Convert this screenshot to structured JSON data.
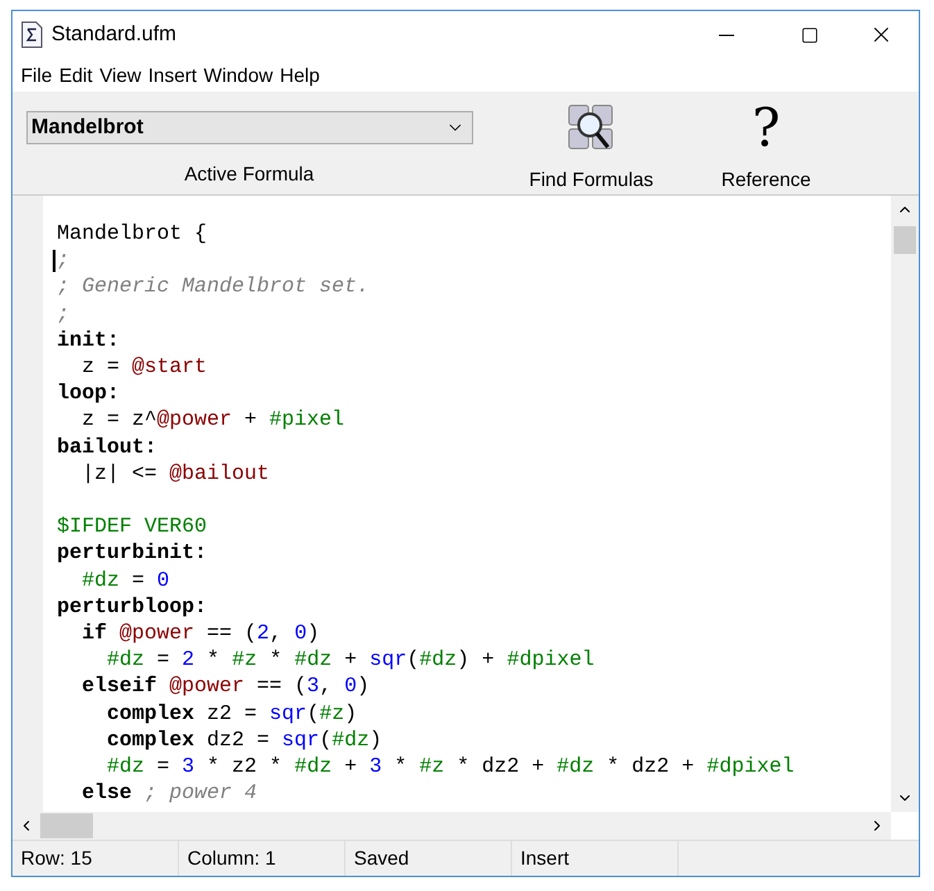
{
  "window": {
    "title": "Standard.ufm"
  },
  "menu": [
    "File",
    "Edit",
    "View",
    "Insert",
    "Window",
    "Help"
  ],
  "toolbar": {
    "formula_select": {
      "value": "Mandelbrot"
    },
    "formula_label": "Active Formula",
    "buttons": [
      {
        "kind": "find",
        "label": "Find Formulas"
      },
      {
        "kind": "help",
        "label": "Reference",
        "glyph": "?"
      }
    ]
  },
  "editor": {
    "lines": [
      {
        "tokens": [
          {
            "kind": "plain",
            "text": "Mandelbrot {"
          }
        ]
      },
      {
        "tokens": [
          {
            "kind": "comment",
            "text": ";"
          }
        ]
      },
      {
        "tokens": [
          {
            "kind": "comment",
            "text": "; Generic Mandelbrot set."
          }
        ]
      },
      {
        "tokens": [
          {
            "kind": "comment",
            "text": ";"
          }
        ]
      },
      {
        "tokens": [
          {
            "kind": "keyword",
            "text": "init:"
          }
        ]
      },
      {
        "tokens": [
          {
            "kind": "plain",
            "text": "  z = "
          },
          {
            "kind": "param",
            "text": "@start"
          }
        ]
      },
      {
        "tokens": [
          {
            "kind": "keyword",
            "text": "loop:"
          }
        ]
      },
      {
        "tokens": [
          {
            "kind": "plain",
            "text": "  z = z^"
          },
          {
            "kind": "param",
            "text": "@power"
          },
          {
            "kind": "plain",
            "text": " + "
          },
          {
            "kind": "var",
            "text": "#pixel"
          }
        ]
      },
      {
        "tokens": [
          {
            "kind": "keyword",
            "text": "bailout:"
          }
        ]
      },
      {
        "tokens": [
          {
            "kind": "plain",
            "text": "  |z| <= "
          },
          {
            "kind": "param",
            "text": "@bailout"
          }
        ]
      },
      {
        "kind": "blank"
      },
      {
        "tokens": [
          {
            "kind": "var",
            "text": "$IFDEF VER60"
          }
        ]
      },
      {
        "tokens": [
          {
            "kind": "keyword",
            "text": "perturbinit:"
          }
        ]
      },
      {
        "tokens": [
          {
            "kind": "var",
            "text": "  #dz"
          },
          {
            "kind": "plain",
            "text": " = "
          },
          {
            "kind": "number",
            "text": "0"
          }
        ]
      },
      {
        "tokens": [
          {
            "kind": "keyword",
            "text": "perturbloop:"
          }
        ]
      },
      {
        "tokens": [
          {
            "kind": "keyword",
            "text": "  if"
          },
          {
            "kind": "param",
            "text": " @power"
          },
          {
            "kind": "plain",
            "text": " == ("
          },
          {
            "kind": "number",
            "text": "2"
          },
          {
            "kind": "plain",
            "text": ", "
          },
          {
            "kind": "number",
            "text": "0"
          },
          {
            "kind": "plain",
            "text": ")"
          }
        ]
      },
      {
        "tokens": [
          {
            "kind": "var",
            "text": "    #dz"
          },
          {
            "kind": "plain",
            "text": " = "
          },
          {
            "kind": "number",
            "text": "2"
          },
          {
            "kind": "plain",
            "text": " * "
          },
          {
            "kind": "var",
            "text": "#z"
          },
          {
            "kind": "plain",
            "text": " * "
          },
          {
            "kind": "var",
            "text": "#dz"
          },
          {
            "kind": "plain",
            "text": " + "
          },
          {
            "kind": "func",
            "text": "sqr"
          },
          {
            "kind": "plain",
            "text": "("
          },
          {
            "kind": "var",
            "text": "#dz"
          },
          {
            "kind": "plain",
            "text": ") + "
          },
          {
            "kind": "var",
            "text": "#dpixel"
          }
        ]
      },
      {
        "tokens": [
          {
            "kind": "keyword",
            "text": "  elseif"
          },
          {
            "kind": "param",
            "text": " @power"
          },
          {
            "kind": "plain",
            "text": " == ("
          },
          {
            "kind": "number",
            "text": "3"
          },
          {
            "kind": "plain",
            "text": ", "
          },
          {
            "kind": "number",
            "text": "0"
          },
          {
            "kind": "plain",
            "text": ")"
          }
        ]
      },
      {
        "tokens": [
          {
            "kind": "keyword",
            "text": "    complex"
          },
          {
            "kind": "plain",
            "text": " z2 = "
          },
          {
            "kind": "func",
            "text": "sqr"
          },
          {
            "kind": "plain",
            "text": "("
          },
          {
            "kind": "var",
            "text": "#z"
          },
          {
            "kind": "plain",
            "text": ")"
          }
        ]
      },
      {
        "tokens": [
          {
            "kind": "keyword",
            "text": "    complex"
          },
          {
            "kind": "plain",
            "text": " dz2 = "
          },
          {
            "kind": "func",
            "text": "sqr"
          },
          {
            "kind": "plain",
            "text": "("
          },
          {
            "kind": "var",
            "text": "#dz"
          },
          {
            "kind": "plain",
            "text": ")"
          }
        ]
      },
      {
        "tokens": [
          {
            "kind": "var",
            "text": "    #dz"
          },
          {
            "kind": "plain",
            "text": " = "
          },
          {
            "kind": "number",
            "text": "3"
          },
          {
            "kind": "plain",
            "text": " * z2 * "
          },
          {
            "kind": "var",
            "text": "#dz"
          },
          {
            "kind": "plain",
            "text": " + "
          },
          {
            "kind": "number",
            "text": "3"
          },
          {
            "kind": "plain",
            "text": " * "
          },
          {
            "kind": "var",
            "text": "#z"
          },
          {
            "kind": "plain",
            "text": " * dz2 + "
          },
          {
            "kind": "var",
            "text": "#dz"
          },
          {
            "kind": "plain",
            "text": " * dz2 + "
          },
          {
            "kind": "var",
            "text": "#dpixel"
          }
        ]
      },
      {
        "tokens": [
          {
            "kind": "keyword",
            "text": "  else"
          },
          {
            "kind": "comment",
            "text": " ; power 4"
          }
        ]
      }
    ]
  },
  "status_bar": [
    "Row: 15",
    "Column: 1",
    "Saved",
    "Insert"
  ]
}
